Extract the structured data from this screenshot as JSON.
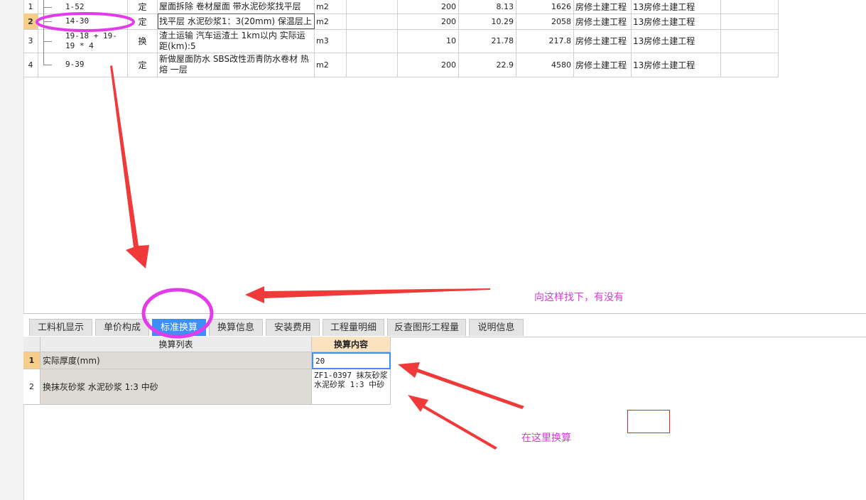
{
  "items": [
    {
      "idx": "1",
      "code": "1-52",
      "type": "定",
      "name": "屋面拆除 卷材屋面 带水泥砂浆找平层",
      "unit": "m2",
      "qty": "200",
      "price": "8.13",
      "total": "1626",
      "cat1": "房修土建工程",
      "cat2": "13房修土建工程"
    },
    {
      "idx": "2",
      "code": "14-30",
      "type": "定",
      "name": "找平层 水泥砂浆1：3(20mm) 保温层上",
      "unit": "m2",
      "qty": "200",
      "price": "10.29",
      "total": "2058",
      "cat1": "房修土建工程",
      "cat2": "13房修土建工程"
    },
    {
      "idx": "3",
      "code": "19-18 + 19-19 * 4",
      "type": "换",
      "name": "渣土运输 汽车运渣土 1km以内  实际运距(km):5",
      "unit": "m3",
      "qty": "10",
      "price": "21.78",
      "total": "217.8",
      "cat1": "房修土建工程",
      "cat2": "13房修土建工程"
    },
    {
      "idx": "4",
      "code": "9-39",
      "type": "定",
      "name": "新做屋面防水 SBS改性沥青防水卷材 热熔 一层",
      "unit": "m2",
      "qty": "200",
      "price": "22.9",
      "total": "4580",
      "cat1": "房修土建工程",
      "cat2": "13房修土建工程"
    }
  ],
  "tabs": [
    "工料机显示",
    "单价构成",
    "标准换算",
    "换算信息",
    "安装费用",
    "工程量明细",
    "反查图形工程量",
    "说明信息"
  ],
  "active_tab": "标准换算",
  "conv": {
    "header_list": "换算列表",
    "header_content": "换算内容",
    "rows": [
      {
        "idx": "1",
        "name": "实际厚度(mm)",
        "value": "20"
      },
      {
        "idx": "2",
        "name": "换抹灰砂浆 水泥砂浆 1:3 中砂",
        "value": "ZF1-0397  抹灰砂浆 水泥砂浆 1:3 中砂"
      }
    ]
  },
  "annotations": {
    "note_top": "向这样找下，有没有",
    "note_bottom": "在这里换算"
  },
  "colors": {
    "accent": "#3e8ef7",
    "annotation_text": "#d63ad6",
    "ellipse": "#e23ce8",
    "arrow": "#f03a3a",
    "selected_row": "#f7cd8a"
  }
}
